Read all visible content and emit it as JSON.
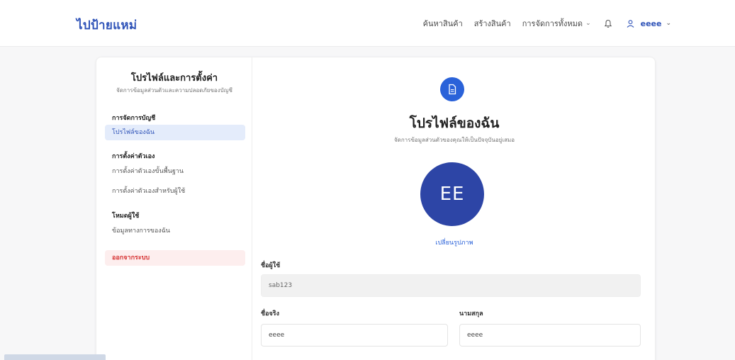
{
  "header": {
    "brand": "ไปป้ายแหม่",
    "nav": [
      {
        "label": "ค้นหาสินค้า"
      },
      {
        "label": "สร้างสินค้า"
      },
      {
        "label": "การจัดการทั้งหมด"
      }
    ],
    "user_name": "eeee"
  },
  "sidebar": {
    "title": "โปรไฟล์และการตั้งค่า",
    "subtitle": "จัดการข้อมูลส่วนตัวและความปลอดภัยของบัญชี",
    "groups": [
      {
        "label": "การจัดการบัญชี",
        "items": [
          {
            "label": "โปรไฟล์ของฉัน"
          }
        ]
      },
      {
        "label": "การตั้งค่าตัวเอง",
        "items": [
          {
            "label": "การตั้งค่าตัวเองขั้นพื้นฐาน"
          },
          {
            "label": "การตั้งค่าตัวเองสำหรับผู้ใช้"
          }
        ]
      },
      {
        "label": "โหมดผู้ใช้",
        "items": [
          {
            "label": "ข้อมูลทางการของฉัน"
          }
        ]
      }
    ],
    "logout": "ออกจากระบบ"
  },
  "main": {
    "title": "โปรไฟล์ของฉัน",
    "subtitle": "จัดการข้อมูลส่วนตัวของคุณให้เป็นปัจจุบันอยู่เสมอ",
    "avatar_initials": "EE",
    "change_photo": "เปลี่ยนรูปภาพ",
    "fields": {
      "username": {
        "label": "ชื่อผู้ใช้",
        "value": "sab123"
      },
      "first_name": {
        "label": "ชื่อจริง",
        "value": "eeee"
      },
      "last_name": {
        "label": "นามสกุล",
        "value": "eeee"
      }
    }
  },
  "colors": {
    "accent": "#2a62d9",
    "avatar": "#2d45a6",
    "brand": "#2f53b8",
    "danger": "#d73737"
  }
}
